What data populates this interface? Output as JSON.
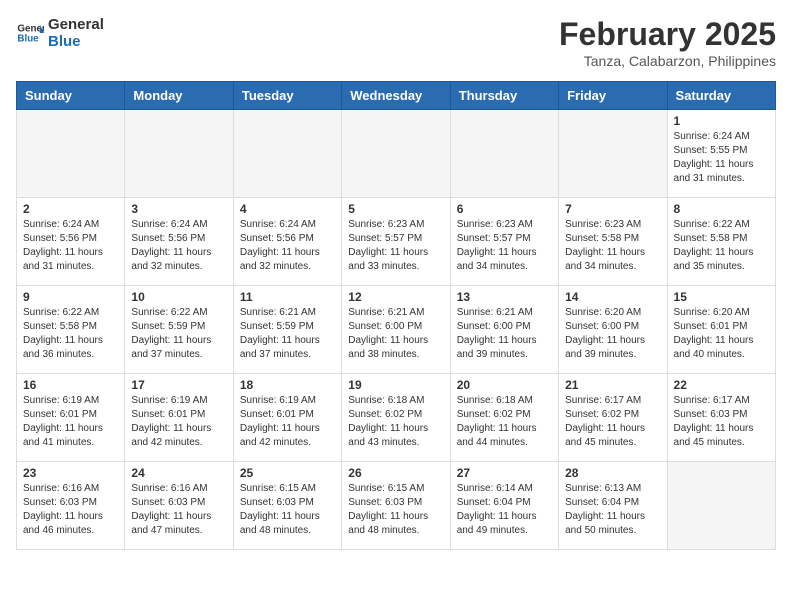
{
  "header": {
    "logo_general": "General",
    "logo_blue": "Blue",
    "month_title": "February 2025",
    "location": "Tanza, Calabarzon, Philippines"
  },
  "days_of_week": [
    "Sunday",
    "Monday",
    "Tuesday",
    "Wednesday",
    "Thursday",
    "Friday",
    "Saturday"
  ],
  "weeks": [
    [
      {
        "day": "",
        "info": ""
      },
      {
        "day": "",
        "info": ""
      },
      {
        "day": "",
        "info": ""
      },
      {
        "day": "",
        "info": ""
      },
      {
        "day": "",
        "info": ""
      },
      {
        "day": "",
        "info": ""
      },
      {
        "day": "1",
        "info": "Sunrise: 6:24 AM\nSunset: 5:55 PM\nDaylight: 11 hours and 31 minutes."
      }
    ],
    [
      {
        "day": "2",
        "info": "Sunrise: 6:24 AM\nSunset: 5:56 PM\nDaylight: 11 hours and 31 minutes."
      },
      {
        "day": "3",
        "info": "Sunrise: 6:24 AM\nSunset: 5:56 PM\nDaylight: 11 hours and 32 minutes."
      },
      {
        "day": "4",
        "info": "Sunrise: 6:24 AM\nSunset: 5:56 PM\nDaylight: 11 hours and 32 minutes."
      },
      {
        "day": "5",
        "info": "Sunrise: 6:23 AM\nSunset: 5:57 PM\nDaylight: 11 hours and 33 minutes."
      },
      {
        "day": "6",
        "info": "Sunrise: 6:23 AM\nSunset: 5:57 PM\nDaylight: 11 hours and 34 minutes."
      },
      {
        "day": "7",
        "info": "Sunrise: 6:23 AM\nSunset: 5:58 PM\nDaylight: 11 hours and 34 minutes."
      },
      {
        "day": "8",
        "info": "Sunrise: 6:22 AM\nSunset: 5:58 PM\nDaylight: 11 hours and 35 minutes."
      }
    ],
    [
      {
        "day": "9",
        "info": "Sunrise: 6:22 AM\nSunset: 5:58 PM\nDaylight: 11 hours and 36 minutes."
      },
      {
        "day": "10",
        "info": "Sunrise: 6:22 AM\nSunset: 5:59 PM\nDaylight: 11 hours and 37 minutes."
      },
      {
        "day": "11",
        "info": "Sunrise: 6:21 AM\nSunset: 5:59 PM\nDaylight: 11 hours and 37 minutes."
      },
      {
        "day": "12",
        "info": "Sunrise: 6:21 AM\nSunset: 6:00 PM\nDaylight: 11 hours and 38 minutes."
      },
      {
        "day": "13",
        "info": "Sunrise: 6:21 AM\nSunset: 6:00 PM\nDaylight: 11 hours and 39 minutes."
      },
      {
        "day": "14",
        "info": "Sunrise: 6:20 AM\nSunset: 6:00 PM\nDaylight: 11 hours and 39 minutes."
      },
      {
        "day": "15",
        "info": "Sunrise: 6:20 AM\nSunset: 6:01 PM\nDaylight: 11 hours and 40 minutes."
      }
    ],
    [
      {
        "day": "16",
        "info": "Sunrise: 6:19 AM\nSunset: 6:01 PM\nDaylight: 11 hours and 41 minutes."
      },
      {
        "day": "17",
        "info": "Sunrise: 6:19 AM\nSunset: 6:01 PM\nDaylight: 11 hours and 42 minutes."
      },
      {
        "day": "18",
        "info": "Sunrise: 6:19 AM\nSunset: 6:01 PM\nDaylight: 11 hours and 42 minutes."
      },
      {
        "day": "19",
        "info": "Sunrise: 6:18 AM\nSunset: 6:02 PM\nDaylight: 11 hours and 43 minutes."
      },
      {
        "day": "20",
        "info": "Sunrise: 6:18 AM\nSunset: 6:02 PM\nDaylight: 11 hours and 44 minutes."
      },
      {
        "day": "21",
        "info": "Sunrise: 6:17 AM\nSunset: 6:02 PM\nDaylight: 11 hours and 45 minutes."
      },
      {
        "day": "22",
        "info": "Sunrise: 6:17 AM\nSunset: 6:03 PM\nDaylight: 11 hours and 45 minutes."
      }
    ],
    [
      {
        "day": "23",
        "info": "Sunrise: 6:16 AM\nSunset: 6:03 PM\nDaylight: 11 hours and 46 minutes."
      },
      {
        "day": "24",
        "info": "Sunrise: 6:16 AM\nSunset: 6:03 PM\nDaylight: 11 hours and 47 minutes."
      },
      {
        "day": "25",
        "info": "Sunrise: 6:15 AM\nSunset: 6:03 PM\nDaylight: 11 hours and 48 minutes."
      },
      {
        "day": "26",
        "info": "Sunrise: 6:15 AM\nSunset: 6:03 PM\nDaylight: 11 hours and 48 minutes."
      },
      {
        "day": "27",
        "info": "Sunrise: 6:14 AM\nSunset: 6:04 PM\nDaylight: 11 hours and 49 minutes."
      },
      {
        "day": "28",
        "info": "Sunrise: 6:13 AM\nSunset: 6:04 PM\nDaylight: 11 hours and 50 minutes."
      },
      {
        "day": "",
        "info": ""
      }
    ]
  ]
}
